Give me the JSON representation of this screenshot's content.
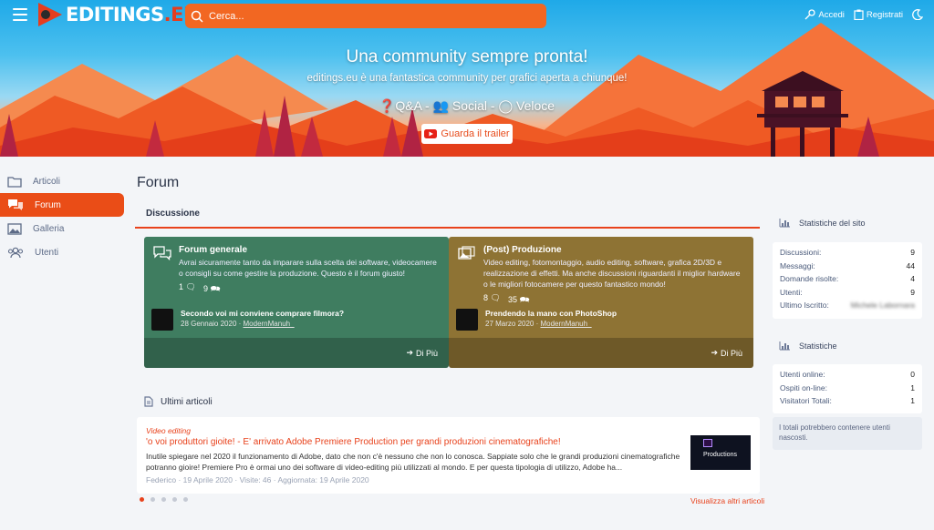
{
  "header": {
    "logo_text_main": "EDITINGS",
    "logo_text_suffix": ".EU",
    "search_placeholder": "Cerca...",
    "login_label": "Accedi",
    "register_label": "Registrati"
  },
  "hero": {
    "title": "Una community sempre pronta!",
    "subtitle": "editings.eu è una fantastica community per grafici aperta a chiunque!",
    "features": "❓Q&A - 👥 Social - ◯ Veloce",
    "trailer_label": "Guarda il trailer"
  },
  "sidebar": {
    "items": [
      {
        "label": "Articoli"
      },
      {
        "label": "Forum"
      },
      {
        "label": "Galleria"
      },
      {
        "label": "Utenti"
      }
    ]
  },
  "main": {
    "title": "Forum",
    "tab": "Discussione",
    "forums": [
      {
        "title": "Forum generale",
        "description": "Avrai sicuramente tanto da imparare sulla scelta dei software, videocamere o consigli su come gestire la produzione. Questo è il forum giusto!",
        "threads": "1",
        "posts": "9",
        "last_title": "Secondo voi mi conviene comprare filmora?",
        "last_date": "28 Gennaio 2020",
        "last_user": "ModernManuh_",
        "more_label": "Di Più",
        "color": "#3f7d60"
      },
      {
        "title": "(Post) Produzione",
        "description": "Video editing, fotomontaggio, audio editing, software, grafica 2D/3D e realizzazione di effetti. Ma anche discussioni riguardanti il miglior hardware o le migliori fotocamere per questo fantastico mondo!",
        "threads": "8",
        "posts": "35",
        "last_title": "Prendendo la mano con PhotoShop",
        "last_date": "27 Marzo 2020",
        "last_user": "ModernManuh_",
        "more_label": "Di Più",
        "color": "#8e7334"
      }
    ],
    "latest_articles_title": "Ultimi articoli",
    "article": {
      "category": "Video editing",
      "title": "'o voi produttori gioite! - E' arrivato Adobe Premiere Production per grandi produzioni cinematografiche!",
      "excerpt": "Inutile spiegare nel 2020 il funzionamento di Adobe, dato che non c'è nessuno che non lo conosca. Sappiate solo che le grandi produzioni cinematografiche potranno gioire! Premiere Pro è ormai uno dei software di video-editing più utilizzati al mondo. E per questa tipologia di utilizzo, Adobe ha...",
      "author": "Federico",
      "date": "19 Aprile 2020",
      "views": "Visite: 46",
      "updated": "Aggiornata: 19 Aprile 2020",
      "image_label": "Productions"
    },
    "more_articles_label": "Visualizza altri articoli"
  },
  "site_stats": {
    "title": "Statistiche del sito",
    "rows": [
      {
        "label": "Discussioni:",
        "value": "9"
      },
      {
        "label": "Messaggi:",
        "value": "44"
      },
      {
        "label": "Domande risolte:",
        "value": "4"
      },
      {
        "label": "Utenti:",
        "value": "9"
      },
      {
        "label": "Ultimo Iscritto:",
        "value": "Michele Labornara"
      }
    ]
  },
  "stats": {
    "title": "Statistiche",
    "rows": [
      {
        "label": "Utenti online:",
        "value": "0"
      },
      {
        "label": "Ospiti on-line:",
        "value": "1"
      },
      {
        "label": "Visitatori Totali:",
        "value": "1"
      }
    ],
    "note": "I totali potrebbero contenere utenti nascosti."
  }
}
